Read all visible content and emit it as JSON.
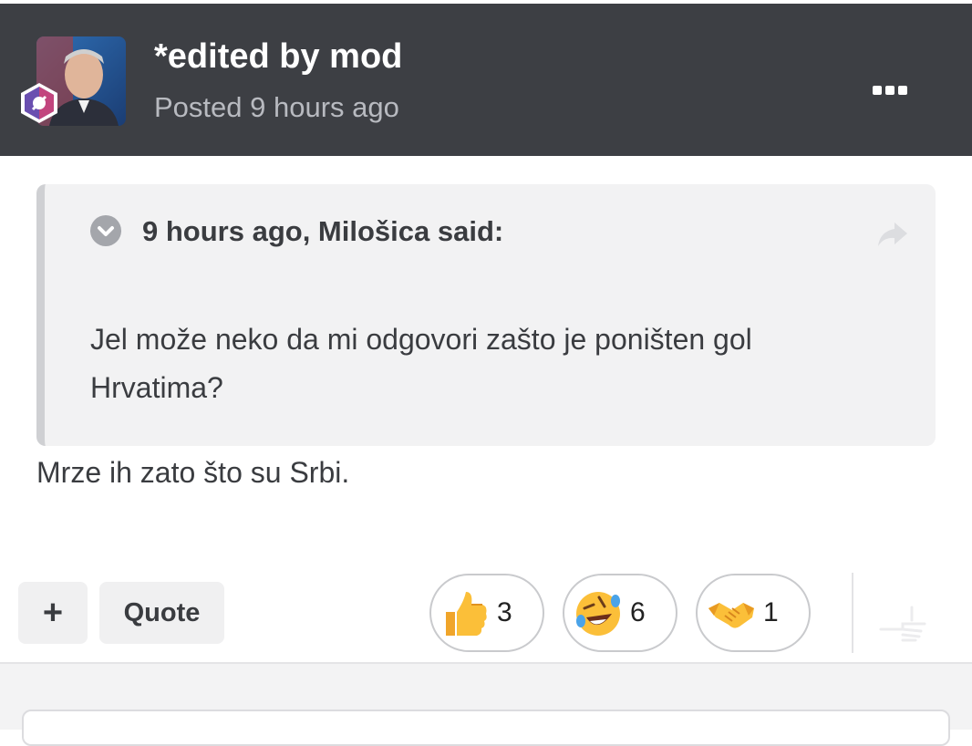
{
  "post": {
    "author": "*edited by mod",
    "posted": "Posted 9 hours ago",
    "avatar_icon": "user-avatar",
    "badge_icon": "rank-badge-icon",
    "more_icon": "ellipsis-icon"
  },
  "quote": {
    "cite": "9 hours ago, Milošica said:",
    "text": "Jel može neko da mi odgovori zašto je poništen gol Hrvatima?",
    "toggle_icon": "chevron-down-icon",
    "share_icon": "share-arrow-icon"
  },
  "reply": {
    "text": "Mrze ih zato što su Srbi."
  },
  "actions": {
    "plus_label": "+",
    "quote_label": "Quote"
  },
  "reactions": [
    {
      "icon": "thumbs-up-icon",
      "count": "3"
    },
    {
      "icon": "rofl-emoji-icon",
      "count": "6"
    },
    {
      "icon": "handshake-icon",
      "count": "1"
    }
  ],
  "colors": {
    "header_bg": "#3d3f44",
    "quote_bg": "#f2f2f3",
    "text": "#3a3c40"
  }
}
